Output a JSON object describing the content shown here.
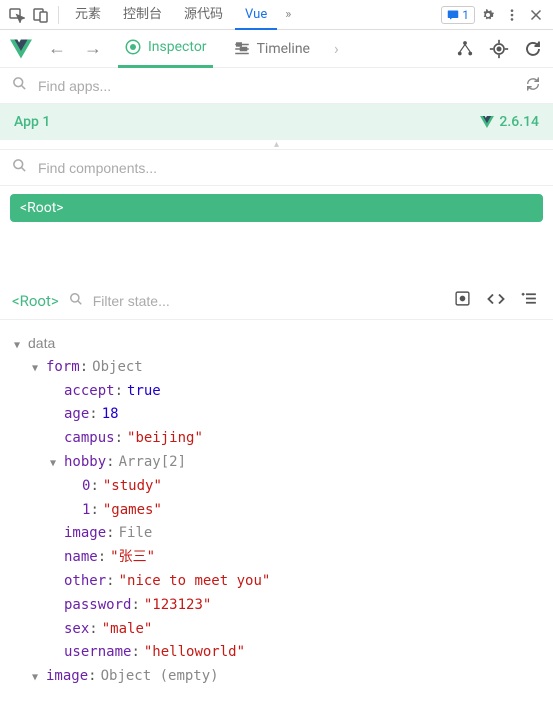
{
  "devtoolsTabs": {
    "elements": "元素",
    "console": "控制台",
    "sources": "源代码",
    "vue": "Vue",
    "more": "»",
    "messageCount": "1"
  },
  "vueTabs": {
    "inspector": "Inspector",
    "timeline": "Timeline"
  },
  "searchApps": {
    "placeholder": "Find apps..."
  },
  "appBar": {
    "name": "App 1",
    "version": "2.6.14"
  },
  "searchComponents": {
    "placeholder": "Find components..."
  },
  "tree": {
    "root": "<Root>"
  },
  "stateHeader": {
    "component": "<Root>",
    "filterPlaceholder": "Filter state..."
  },
  "data": {
    "sectionLabel": "data",
    "form": {
      "label": "form",
      "type": "Object",
      "accept": {
        "key": "accept",
        "value": "true"
      },
      "age": {
        "key": "age",
        "value": "18"
      },
      "campus": {
        "key": "campus",
        "value": "\"beijing\""
      },
      "hobby": {
        "key": "hobby",
        "type": "Array[2]",
        "items": [
          {
            "key": "0",
            "value": "\"study\""
          },
          {
            "key": "1",
            "value": "\"games\""
          }
        ]
      },
      "image": {
        "key": "image",
        "value": "File"
      },
      "name": {
        "key": "name",
        "value": "\"张三\""
      },
      "other": {
        "key": "other",
        "value": "\"nice to meet you\""
      },
      "password": {
        "key": "password",
        "value": "\"123123\""
      },
      "sex": {
        "key": "sex",
        "value": "\"male\""
      },
      "username": {
        "key": "username",
        "value": "\"helloworld\""
      }
    },
    "image": {
      "label": "image",
      "type": "Object (empty)"
    }
  }
}
